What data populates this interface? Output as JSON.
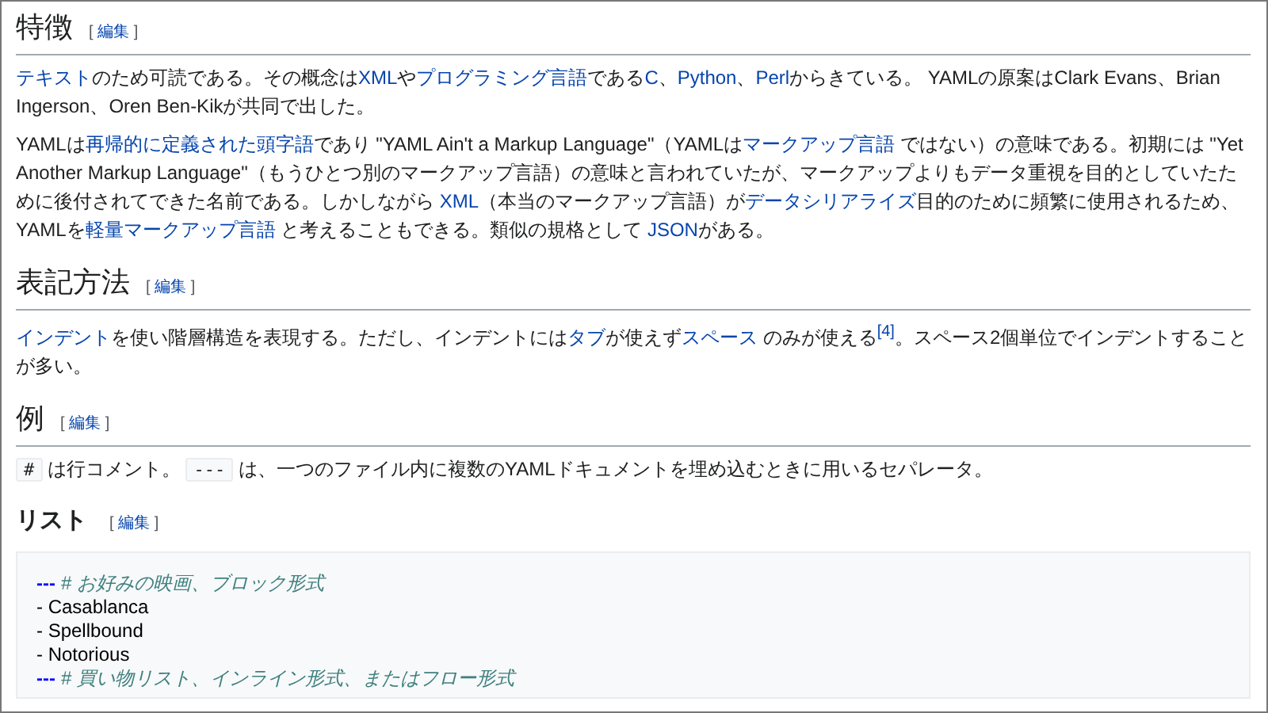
{
  "sections": [
    {
      "heading": "特徴",
      "kind": "heading",
      "edit": [
        "[",
        "編集",
        "]"
      ],
      "paragraphs": [
        [
          {
            "kind": "link",
            "text": "テキスト"
          },
          {
            "kind": "text",
            "text": "のため可読である。その概念は"
          },
          {
            "kind": "link",
            "text": "XML"
          },
          {
            "kind": "text",
            "text": "や"
          },
          {
            "kind": "link",
            "text": "プログラミング言語"
          },
          {
            "kind": "text",
            "text": "である"
          },
          {
            "kind": "link",
            "text": "C"
          },
          {
            "kind": "text",
            "text": "、"
          },
          {
            "kind": "link",
            "text": "Python"
          },
          {
            "kind": "text",
            "text": "、"
          },
          {
            "kind": "link",
            "text": "Perl"
          },
          {
            "kind": "text",
            "text": "からきている。 YAMLの原案はClark Evans、Brian Ingerson、Oren Ben-Kikが共同で出した。"
          }
        ],
        [
          {
            "kind": "text",
            "text": "YAMLは"
          },
          {
            "kind": "link",
            "text": "再帰的に定義された頭字語"
          },
          {
            "kind": "text",
            "text": "であり \"YAML Ain't a Markup Language\"（YAMLは"
          },
          {
            "kind": "link",
            "text": "マークアップ言語"
          },
          {
            "kind": "text",
            "text": " ではない）の意味である。初期には \"Yet Another Markup Language\"（もうひとつ別のマークアップ言語）の意味と言われていたが、マークアップよりもデータ重視を目的としていたために後付されてできた名前である。しかしながら "
          },
          {
            "kind": "link",
            "text": "XML"
          },
          {
            "kind": "text",
            "text": "（本当のマークアップ言語）が"
          },
          {
            "kind": "link",
            "text": "データシリアライズ"
          },
          {
            "kind": "text",
            "text": "目的のために頻繁に使用されるため、 YAMLを"
          },
          {
            "kind": "link",
            "text": "軽量マークアップ言語"
          },
          {
            "kind": "text",
            "text": " と考えることもできる。類似の規格として "
          },
          {
            "kind": "link",
            "text": "JSON"
          },
          {
            "kind": "text",
            "text": "がある。"
          }
        ]
      ]
    },
    {
      "heading": "表記方法",
      "kind": "heading",
      "edit": [
        "[",
        "編集",
        "]"
      ],
      "paragraphs": [
        [
          {
            "kind": "link",
            "text": "インデント"
          },
          {
            "kind": "text",
            "text": "を使い階層構造を表現する。ただし、インデントには"
          },
          {
            "kind": "link",
            "text": "タブ"
          },
          {
            "kind": "text",
            "text": "が使えず"
          },
          {
            "kind": "link",
            "text": "スペース"
          },
          {
            "kind": "text",
            "text": " のみが使える"
          },
          {
            "kind": "ref",
            "text": "[4]"
          },
          {
            "kind": "text",
            "text": "。スペース2個単位でインデントすることが多い。"
          }
        ]
      ]
    },
    {
      "heading": "例",
      "kind": "heading",
      "edit": [
        "[",
        "編集",
        "]"
      ],
      "paragraphs": [
        [
          {
            "kind": "code",
            "text": "#"
          },
          {
            "kind": "text",
            "text": " は行コメント。 "
          },
          {
            "kind": "code",
            "text": "---"
          },
          {
            "kind": "text",
            "text": " は、一つのファイル内に複数のYAMLドキュメントを埋め込むときに用いるセパレータ。"
          }
        ]
      ]
    },
    {
      "heading": "リスト",
      "kind": "subheading",
      "edit": [
        "[",
        "編集",
        "]"
      ],
      "code_block": [
        [
          {
            "kind": "marker",
            "text": "---"
          },
          {
            "kind": "comment",
            "text": "# お好みの映画、ブロック形式"
          }
        ],
        [
          {
            "kind": "plain",
            "text": "- Casablanca"
          }
        ],
        [
          {
            "kind": "plain",
            "text": "- Spellbound"
          }
        ],
        [
          {
            "kind": "plain",
            "text": "- Notorious"
          }
        ],
        [
          {
            "kind": "marker",
            "text": "---"
          },
          {
            "kind": "comment",
            "text": "# 買い物リスト、インライン形式、またはフロー形式"
          }
        ]
      ]
    }
  ]
}
